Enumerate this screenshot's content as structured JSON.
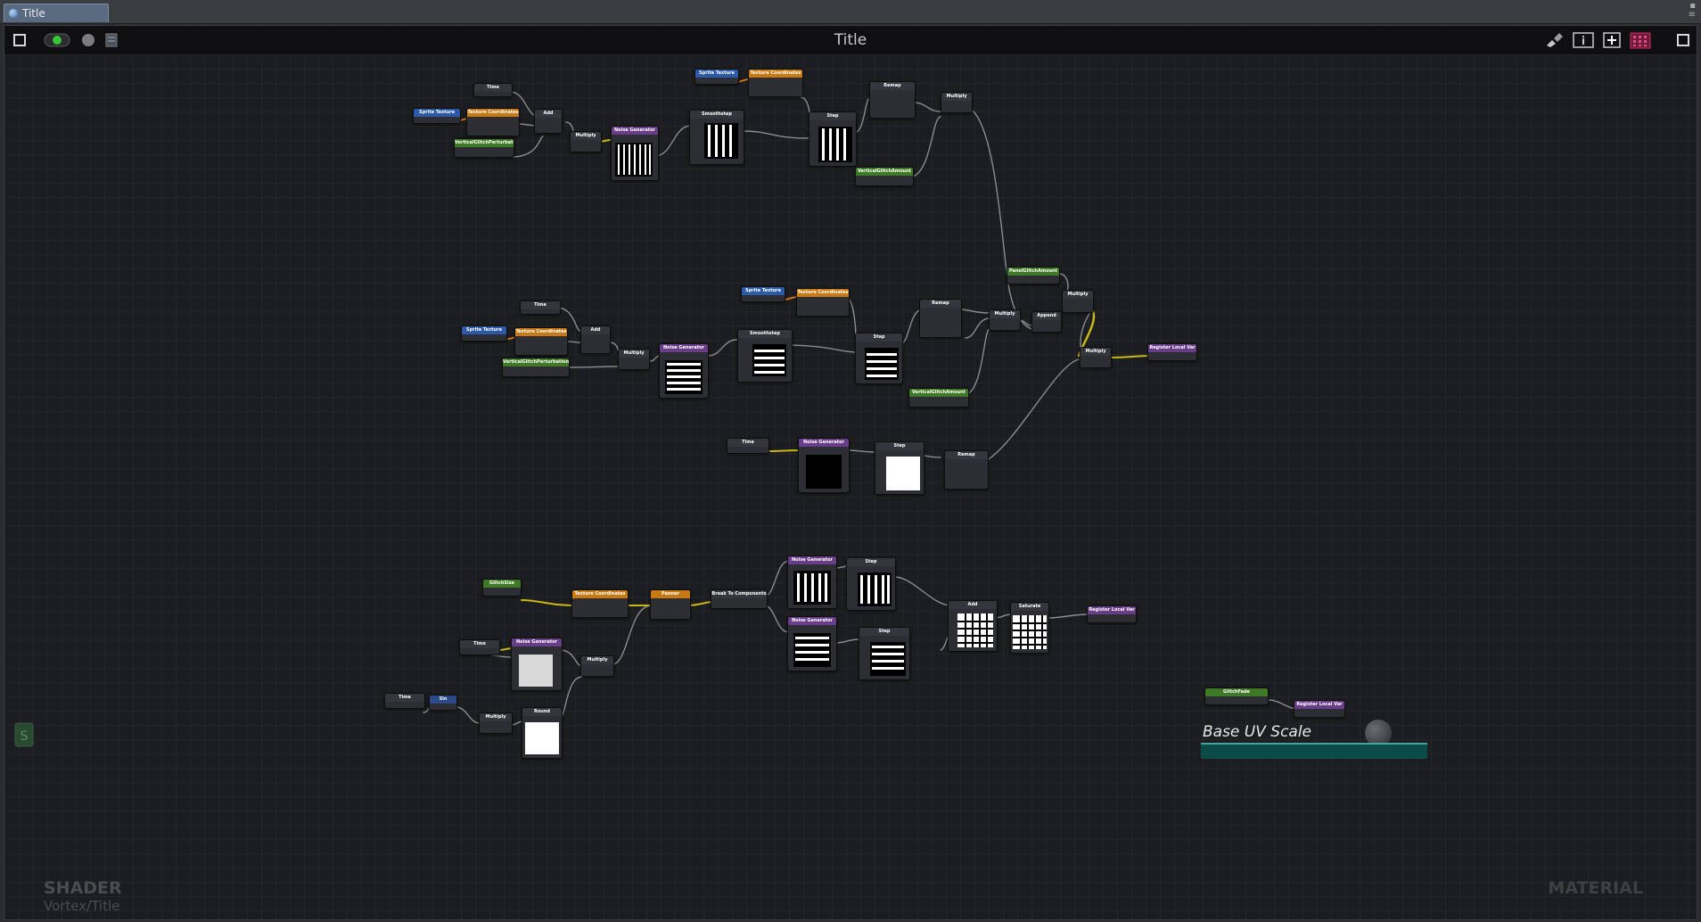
{
  "window": {
    "tab_title": "Title",
    "controls_glyph": "▪\n≡"
  },
  "toolbar": {
    "title": "Title"
  },
  "watermark": {
    "shader_label": "SHADER",
    "path": "Vortex/Title",
    "material_label": "MATERIAL"
  },
  "annotation": {
    "text": "Base UV Scale"
  },
  "colors": {
    "blue": "#2c5aa8",
    "orange": "#c77a14",
    "green": "#3e7a26",
    "purple": "#6a3d8a",
    "dark": "#33363c",
    "wire": "#8a8c90",
    "wire_yellow": "#c8b818"
  },
  "nodes": {
    "time": "Time",
    "sampler": "Sprite Texture",
    "texcoord": "Texture Coordinates",
    "add": "Add",
    "multiply": "Multiply",
    "noise": "Noise Generator",
    "smoothstep": "Smoothstep",
    "step": "Step",
    "remap": "Remap",
    "panner": "Panner",
    "break": "Break To Components",
    "saturate": "Saturate",
    "register": "Register Local Var",
    "sin": "Sin",
    "round": "Round",
    "append": "Append",
    "vertical_glitch": "VerticalGlitchPerturbation",
    "vertical_amount": "VerticalGlitchAmount",
    "panel_amount": "PanelGlitchAmount",
    "glitch_fade": "GlitchFade",
    "glitch_size": "GlitchSize"
  }
}
